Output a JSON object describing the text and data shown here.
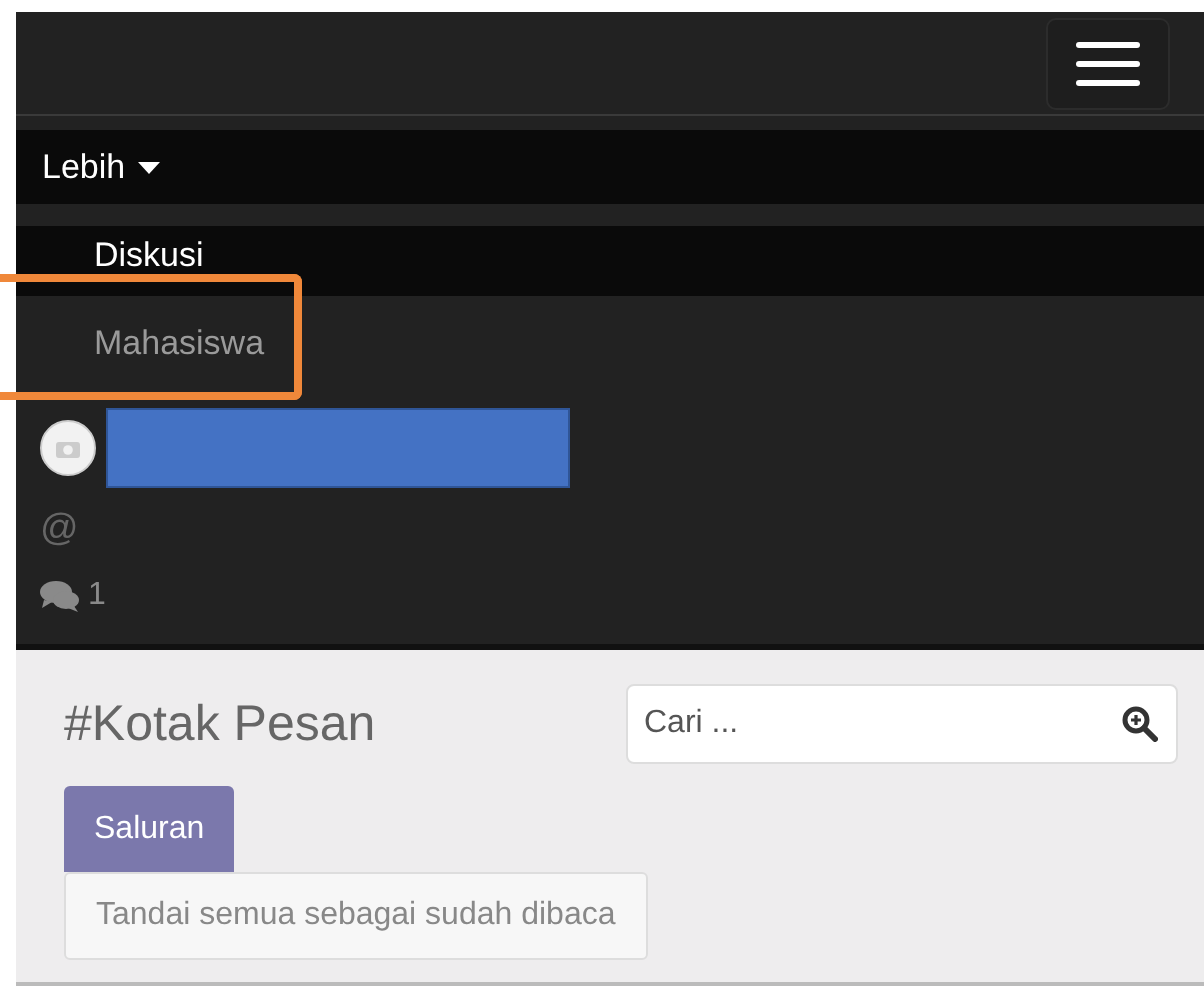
{
  "dropdown": {
    "label": "Lebih",
    "expanded": true,
    "items": [
      {
        "label": "Diskusi",
        "selected": true
      },
      {
        "label": "Mahasiswa",
        "selected": false
      }
    ]
  },
  "highlight": {
    "color": "#f0883a"
  },
  "user": {
    "at": "@",
    "comments": "1"
  },
  "content": {
    "title": "#Kotak Pesan",
    "search": {
      "placeholder": "Cari ..."
    },
    "channel_button": "Saluran",
    "mark_read_button": "Tandai semua sebagai sudah dibaca"
  }
}
